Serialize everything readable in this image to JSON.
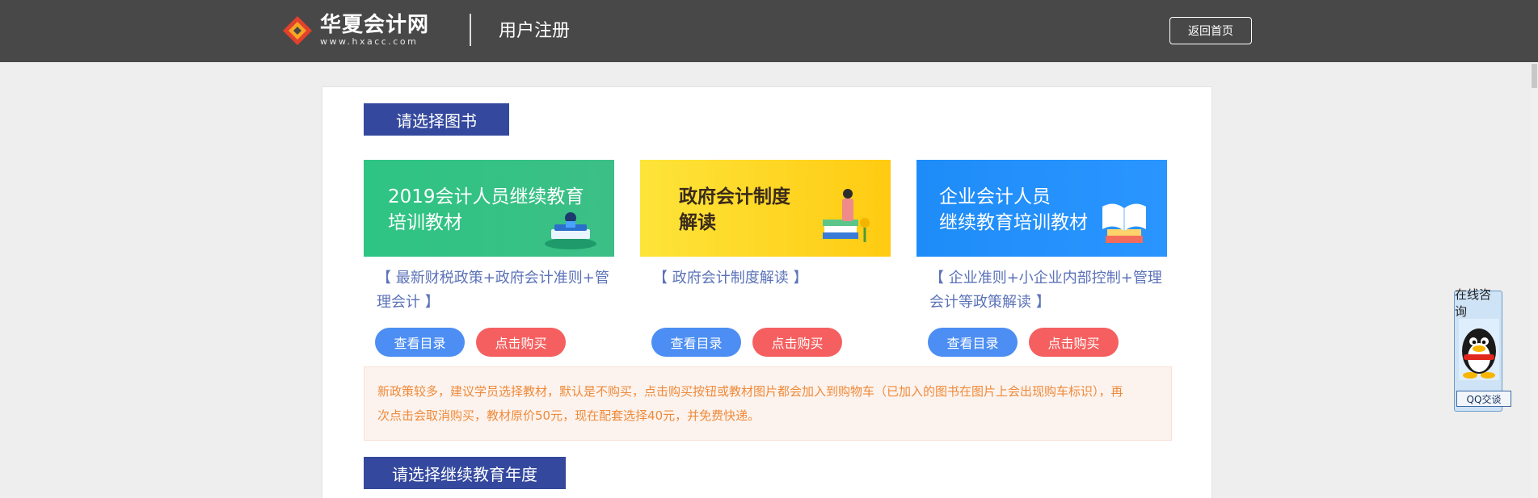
{
  "header": {
    "logo_name": "华夏会计网",
    "logo_url": "www.hxacc.com",
    "page_title": "用户注册",
    "home_button": "返回首页"
  },
  "sections": {
    "choose_book": "请选择图书",
    "choose_year": "请选择继续教育年度"
  },
  "books": [
    {
      "cover_title_line1": "2019会计人员继续教育",
      "cover_title_line2": "培训教材",
      "description": "【 最新财税政策+政府会计准则+管理会计 】",
      "catalog_button": "查看目录",
      "buy_button": "点击购买",
      "color": "#34c384"
    },
    {
      "cover_title_line1": "政府会计制度",
      "cover_title_line2": "解读",
      "description": "【 政府会计制度解读 】",
      "catalog_button": "查看目录",
      "buy_button": "点击购买",
      "color": "#fed52a"
    },
    {
      "cover_title_line1": "企业会计人员",
      "cover_title_line2": "继续教育培训教材",
      "description": "【 企业准则+小企业内部控制+管理会计等政策解读 】",
      "catalog_button": "查看目录",
      "buy_button": "点击购买",
      "color": "#2592fd"
    }
  ],
  "notice": "新政策较多，建议学员选择教材，默认是不购买，点击购买按钮或教材图片都会加入到购物车（已加入的图书在图片上会出现购车标识），再次点击会取消购买，教材原价50元，现在配套选择40元，并免费快递。",
  "qq_widget": {
    "title": "在线咨询",
    "button": "QQ交谈"
  },
  "colors": {
    "header_bg": "#484848",
    "section_title_bg": "#34499e",
    "catalog_button": "#4c8ef3",
    "buy_button": "#f55f5f",
    "notice_text": "#ee8a3a"
  }
}
